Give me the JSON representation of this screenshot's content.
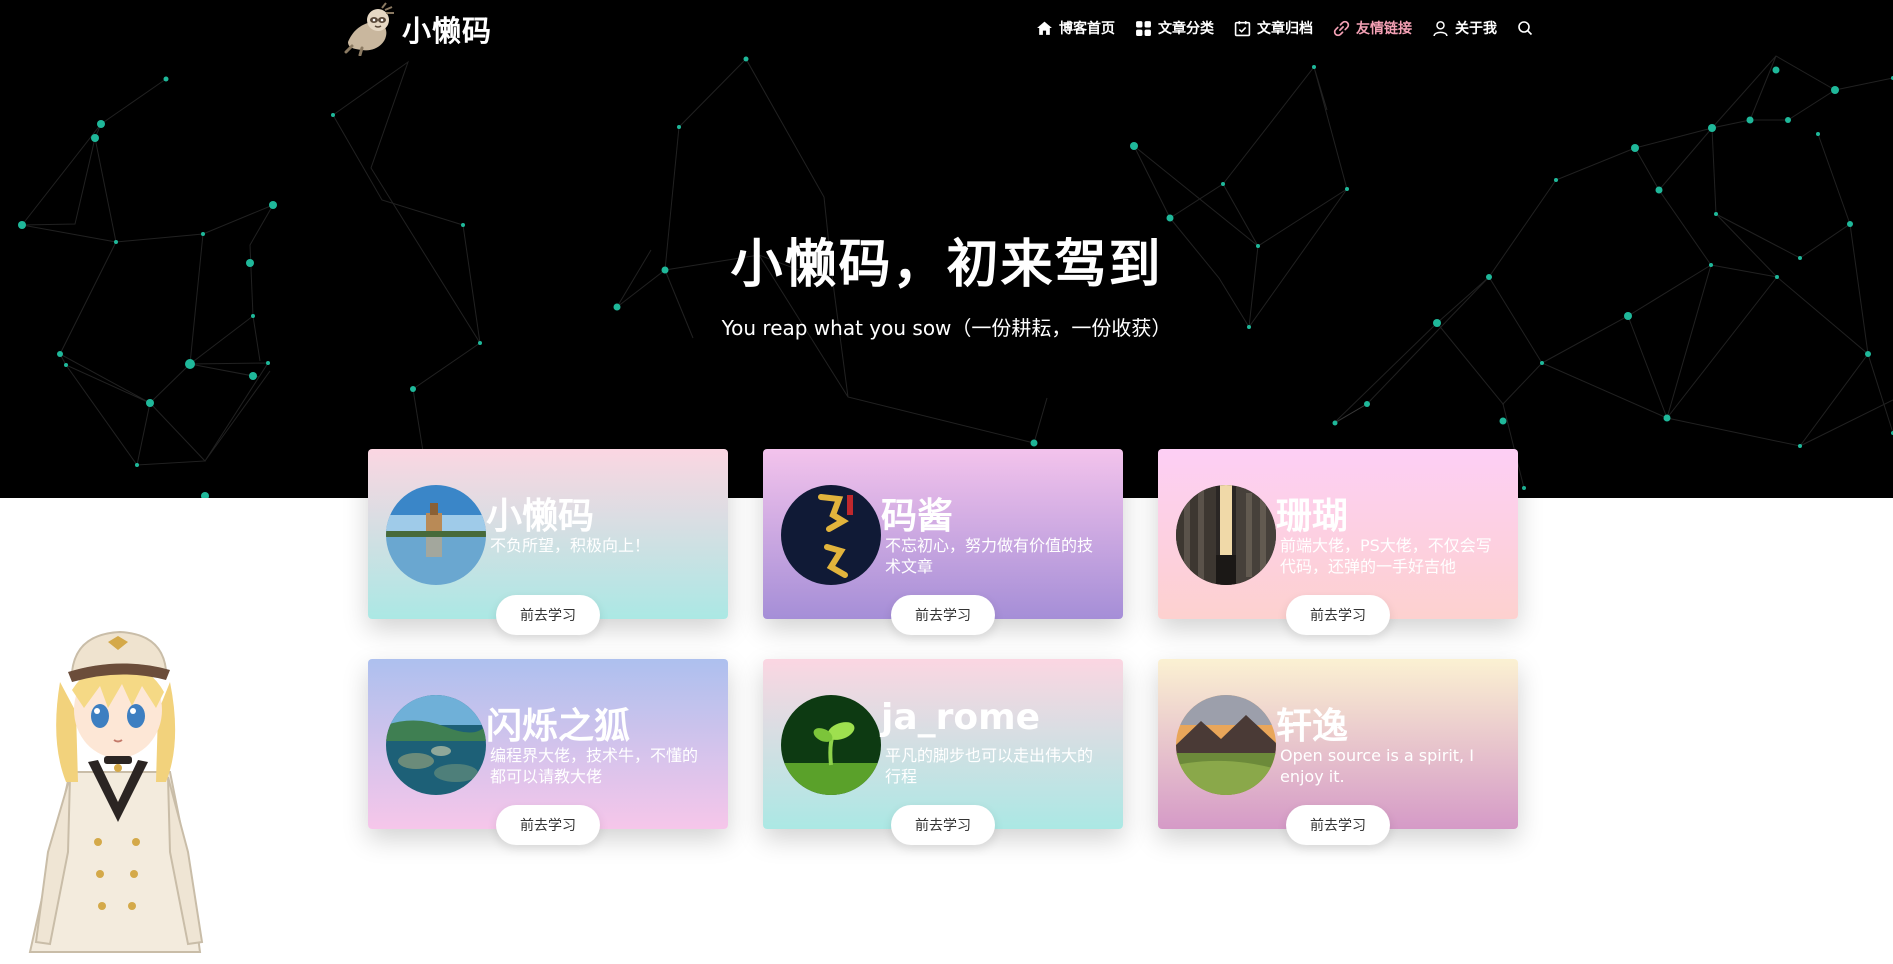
{
  "header": {
    "logo_text": "小懒码",
    "nav": [
      {
        "label": "博客首页",
        "icon": "home-icon"
      },
      {
        "label": "文章分类",
        "icon": "grid-icon"
      },
      {
        "label": "文章归档",
        "icon": "calendar-check-icon"
      },
      {
        "label": "友情链接",
        "icon": "link-icon",
        "active": true
      },
      {
        "label": "关于我",
        "icon": "user-icon"
      }
    ],
    "search_icon": "search-icon"
  },
  "hero": {
    "title": "小懒码，初来驾到",
    "subtitle": "You reap what you sow（一份耕耘，一份收获）"
  },
  "colors": {
    "hero_bg": "#000000",
    "network_node": "#1fb89a",
    "active_nav": "#f3a0b4"
  },
  "friends": [
    {
      "name": "小懒码",
      "desc": "不负所望，积极向上！",
      "button": "前去学习"
    },
    {
      "name": "码酱",
      "desc": "不忘初心，努力做有价值的技术文章",
      "button": "前去学习"
    },
    {
      "name": "珊瑚",
      "desc": "前端大佬，PS大佬，不仅会写代码，还弹的一手好吉他",
      "button": "前去学习"
    },
    {
      "name": "闪烁之狐",
      "desc": "编程界大佬，技术牛，不懂的都可以请教大佬",
      "button": "前去学习"
    },
    {
      "name": "ja_rome",
      "desc": "平凡的脚步也可以走出伟大的行程",
      "button": "前去学习"
    },
    {
      "name": "轩逸",
      "desc": "Open source is a spirit, I enjoy it.",
      "button": "前去学习"
    }
  ]
}
